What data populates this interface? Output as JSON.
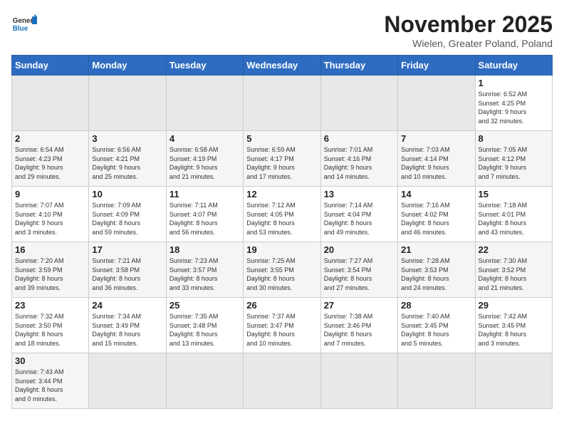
{
  "header": {
    "logo_general": "General",
    "logo_blue": "Blue",
    "title": "November 2025",
    "subtitle": "Wielen, Greater Poland, Poland"
  },
  "weekdays": [
    "Sunday",
    "Monday",
    "Tuesday",
    "Wednesday",
    "Thursday",
    "Friday",
    "Saturday"
  ],
  "weeks": [
    [
      {
        "day": "",
        "info": ""
      },
      {
        "day": "",
        "info": ""
      },
      {
        "day": "",
        "info": ""
      },
      {
        "day": "",
        "info": ""
      },
      {
        "day": "",
        "info": ""
      },
      {
        "day": "",
        "info": ""
      },
      {
        "day": "1",
        "info": "Sunrise: 6:52 AM\nSunset: 4:25 PM\nDaylight: 9 hours\nand 32 minutes."
      }
    ],
    [
      {
        "day": "2",
        "info": "Sunrise: 6:54 AM\nSunset: 4:23 PM\nDaylight: 9 hours\nand 29 minutes."
      },
      {
        "day": "3",
        "info": "Sunrise: 6:56 AM\nSunset: 4:21 PM\nDaylight: 9 hours\nand 25 minutes."
      },
      {
        "day": "4",
        "info": "Sunrise: 6:58 AM\nSunset: 4:19 PM\nDaylight: 9 hours\nand 21 minutes."
      },
      {
        "day": "5",
        "info": "Sunrise: 6:59 AM\nSunset: 4:17 PM\nDaylight: 9 hours\nand 17 minutes."
      },
      {
        "day": "6",
        "info": "Sunrise: 7:01 AM\nSunset: 4:16 PM\nDaylight: 9 hours\nand 14 minutes."
      },
      {
        "day": "7",
        "info": "Sunrise: 7:03 AM\nSunset: 4:14 PM\nDaylight: 9 hours\nand 10 minutes."
      },
      {
        "day": "8",
        "info": "Sunrise: 7:05 AM\nSunset: 4:12 PM\nDaylight: 9 hours\nand 7 minutes."
      }
    ],
    [
      {
        "day": "9",
        "info": "Sunrise: 7:07 AM\nSunset: 4:10 PM\nDaylight: 9 hours\nand 3 minutes."
      },
      {
        "day": "10",
        "info": "Sunrise: 7:09 AM\nSunset: 4:09 PM\nDaylight: 8 hours\nand 59 minutes."
      },
      {
        "day": "11",
        "info": "Sunrise: 7:11 AM\nSunset: 4:07 PM\nDaylight: 8 hours\nand 56 minutes."
      },
      {
        "day": "12",
        "info": "Sunrise: 7:12 AM\nSunset: 4:05 PM\nDaylight: 8 hours\nand 53 minutes."
      },
      {
        "day": "13",
        "info": "Sunrise: 7:14 AM\nSunset: 4:04 PM\nDaylight: 8 hours\nand 49 minutes."
      },
      {
        "day": "14",
        "info": "Sunrise: 7:16 AM\nSunset: 4:02 PM\nDaylight: 8 hours\nand 46 minutes."
      },
      {
        "day": "15",
        "info": "Sunrise: 7:18 AM\nSunset: 4:01 PM\nDaylight: 8 hours\nand 43 minutes."
      }
    ],
    [
      {
        "day": "16",
        "info": "Sunrise: 7:20 AM\nSunset: 3:59 PM\nDaylight: 8 hours\nand 39 minutes."
      },
      {
        "day": "17",
        "info": "Sunrise: 7:21 AM\nSunset: 3:58 PM\nDaylight: 8 hours\nand 36 minutes."
      },
      {
        "day": "18",
        "info": "Sunrise: 7:23 AM\nSunset: 3:57 PM\nDaylight: 8 hours\nand 33 minutes."
      },
      {
        "day": "19",
        "info": "Sunrise: 7:25 AM\nSunset: 3:55 PM\nDaylight: 8 hours\nand 30 minutes."
      },
      {
        "day": "20",
        "info": "Sunrise: 7:27 AM\nSunset: 3:54 PM\nDaylight: 8 hours\nand 27 minutes."
      },
      {
        "day": "21",
        "info": "Sunrise: 7:28 AM\nSunset: 3:53 PM\nDaylight: 8 hours\nand 24 minutes."
      },
      {
        "day": "22",
        "info": "Sunrise: 7:30 AM\nSunset: 3:52 PM\nDaylight: 8 hours\nand 21 minutes."
      }
    ],
    [
      {
        "day": "23",
        "info": "Sunrise: 7:32 AM\nSunset: 3:50 PM\nDaylight: 8 hours\nand 18 minutes."
      },
      {
        "day": "24",
        "info": "Sunrise: 7:34 AM\nSunset: 3:49 PM\nDaylight: 8 hours\nand 15 minutes."
      },
      {
        "day": "25",
        "info": "Sunrise: 7:35 AM\nSunset: 3:48 PM\nDaylight: 8 hours\nand 13 minutes."
      },
      {
        "day": "26",
        "info": "Sunrise: 7:37 AM\nSunset: 3:47 PM\nDaylight: 8 hours\nand 10 minutes."
      },
      {
        "day": "27",
        "info": "Sunrise: 7:38 AM\nSunset: 3:46 PM\nDaylight: 8 hours\nand 7 minutes."
      },
      {
        "day": "28",
        "info": "Sunrise: 7:40 AM\nSunset: 3:45 PM\nDaylight: 8 hours\nand 5 minutes."
      },
      {
        "day": "29",
        "info": "Sunrise: 7:42 AM\nSunset: 3:45 PM\nDaylight: 8 hours\nand 3 minutes."
      }
    ],
    [
      {
        "day": "30",
        "info": "Sunrise: 7:43 AM\nSunset: 3:44 PM\nDaylight: 8 hours\nand 0 minutes."
      },
      {
        "day": "",
        "info": ""
      },
      {
        "day": "",
        "info": ""
      },
      {
        "day": "",
        "info": ""
      },
      {
        "day": "",
        "info": ""
      },
      {
        "day": "",
        "info": ""
      },
      {
        "day": "",
        "info": ""
      }
    ]
  ]
}
